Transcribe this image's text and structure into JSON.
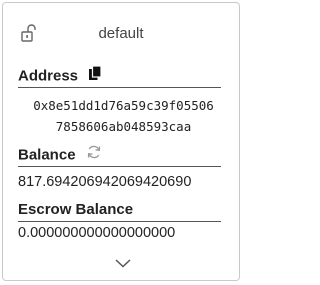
{
  "account": {
    "name": "default",
    "lock_icon": "unlocked-padlock-icon"
  },
  "address": {
    "label": "Address",
    "copy_icon": "copy-icon",
    "line1": "0x8e51dd1d76a59c39f05506",
    "line2": "7858606ab048593caa"
  },
  "balance": {
    "label": "Balance",
    "refresh_icon": "refresh-icon",
    "value": "817.694206942069420690"
  },
  "escrow": {
    "label": "Escrow Balance",
    "value": "0.000000000000000000"
  },
  "footer": {
    "expand_icon": "chevron-down-icon"
  }
}
